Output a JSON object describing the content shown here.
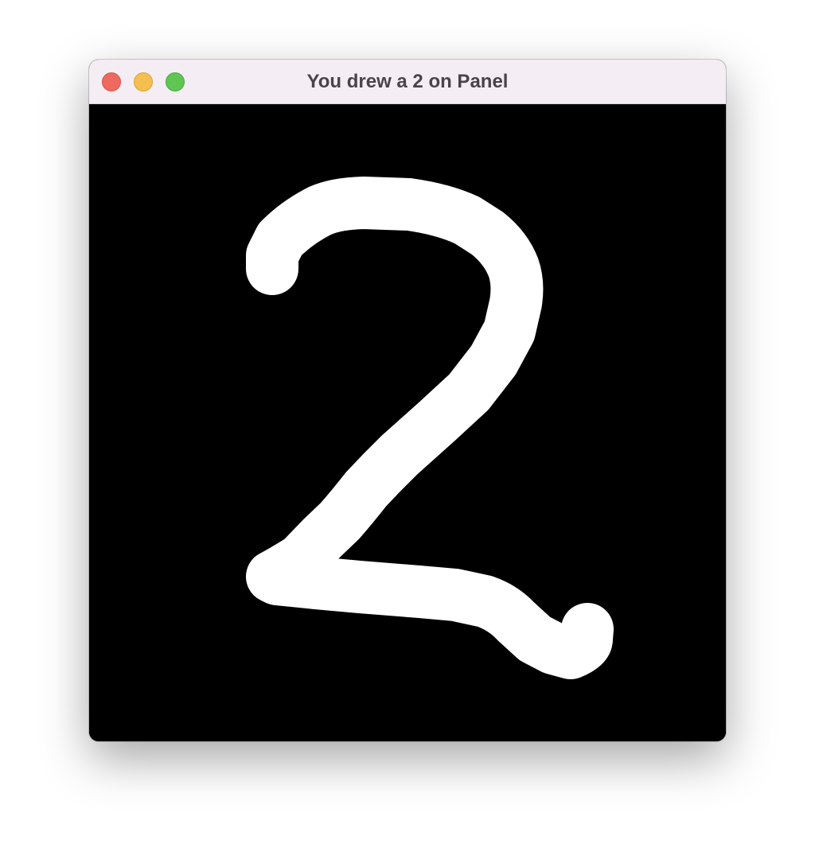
{
  "window": {
    "title": "You drew a 2 on Panel",
    "controls": {
      "close": "close-icon",
      "minimize": "minimize-icon",
      "maximize": "maximize-icon"
    },
    "colors": {
      "titlebar": "#f4edf4",
      "title_text": "#4a4448",
      "close": "#ee6a5f",
      "minimize": "#f5bf4f",
      "maximize": "#61c554"
    }
  },
  "panel": {
    "background_color": "#000000",
    "stroke_color": "#ffffff",
    "drawn_digit": "2"
  }
}
